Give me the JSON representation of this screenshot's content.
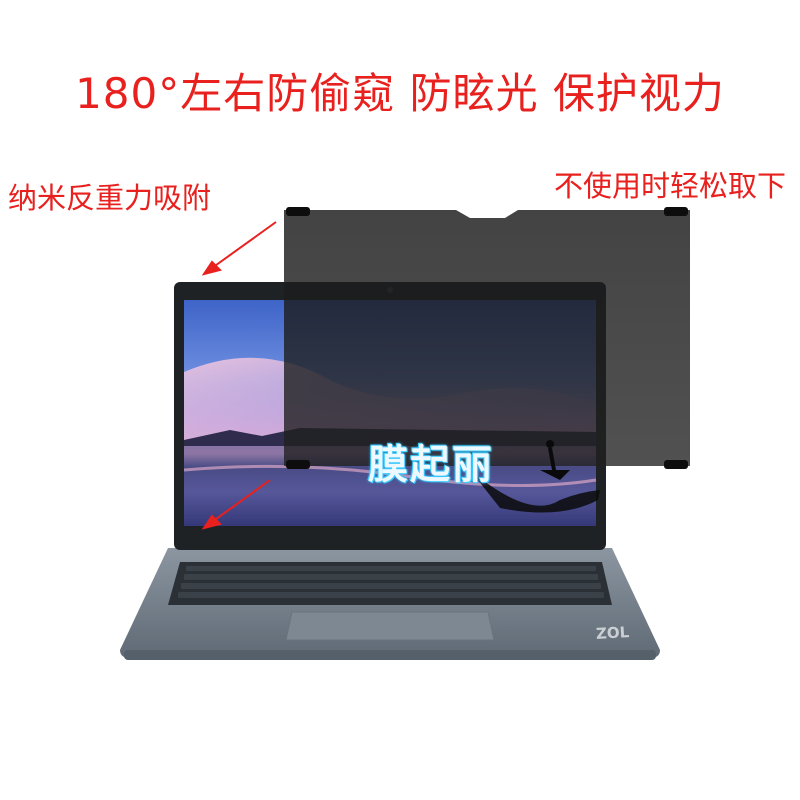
{
  "headline": "180°左右防偷窥 防眩光 保护视力",
  "labels": {
    "left": "纳米反重力吸附",
    "right": "不使用时轻松取下"
  },
  "watermark": "膜起丽",
  "brand": "ZOL",
  "colors": {
    "text_red": "#e8201e",
    "laptop_body": "#6f7a86",
    "privacy_filter": "#3a3a3a",
    "screen_sky": "#5a7fd0",
    "screen_sunset": "#e8a6c0"
  }
}
